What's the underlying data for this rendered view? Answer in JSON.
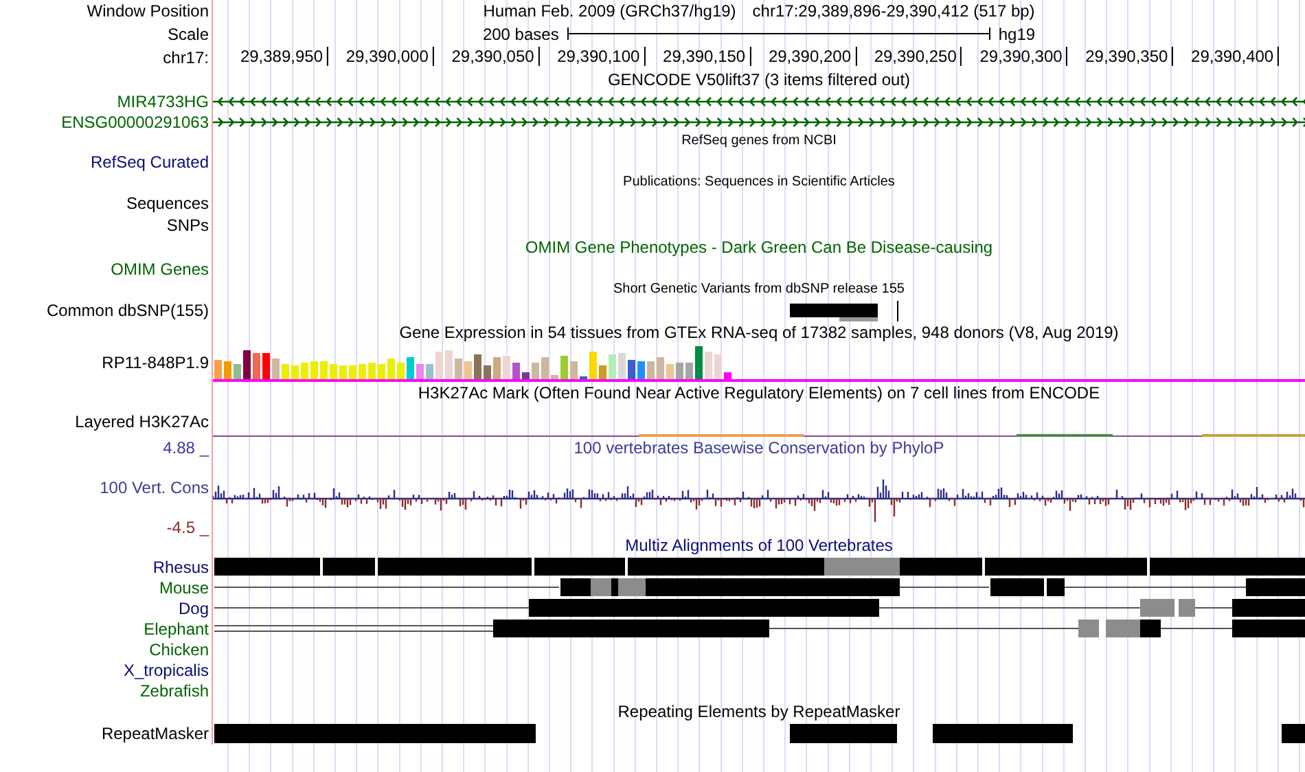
{
  "rows": [
    {
      "kind": "position",
      "label": "Window Position",
      "assembly": "Human Feb. 2009 (GRCh37/hg19)",
      "position": "chr17:29,389,896-29,390,412 (517 bp)"
    },
    {
      "kind": "scale",
      "label": "Scale",
      "bases": "200 bases",
      "db": "hg19"
    },
    {
      "kind": "ruler",
      "label": "chr17:",
      "ticks": [
        "29,389,950",
        "29,390,000",
        "29,390,050",
        "29,390,100",
        "29,390,150",
        "29,390,200",
        "29,390,250",
        "29,390,300",
        "29,390,350",
        "29,390,400"
      ]
    },
    {
      "kind": "title",
      "title": "GENCODE V50lift37 (3 items filtered out)",
      "color": "#000000"
    },
    {
      "kind": "gene",
      "label": "MIR4733HG",
      "color": "#006400",
      "reverse": true
    },
    {
      "kind": "gene",
      "label": "ENSG00000291063",
      "color": "#006400",
      "reverse": false
    },
    {
      "kind": "small_title",
      "title": "RefSeq genes from NCBI"
    },
    {
      "kind": "label",
      "label": "RefSeq Curated",
      "color": "#0c0c78"
    },
    {
      "kind": "small_title",
      "title": "Publications: Sequences in Scientific Articles"
    },
    {
      "kind": "label",
      "label": "Sequences",
      "color": "#000000"
    },
    {
      "kind": "label",
      "label": "SNPs",
      "color": "#000000"
    },
    {
      "kind": "title",
      "title": "OMIM Gene Phenotypes - Dark Green Can Be Disease-causing",
      "color": "#006400"
    },
    {
      "kind": "label",
      "label": "OMIM Genes",
      "color": "#006400"
    },
    {
      "kind": "small_title",
      "title": "Short Genetic Variants from dbSNP release 155"
    },
    {
      "kind": "snp",
      "label": "Common dbSNP(155)",
      "color": "#000000"
    },
    {
      "kind": "title",
      "title": "Gene Expression in 54 tissues from GTEx RNA-seq of 17382 samples, 948 donors (V8, Aug 2019)",
      "color": "#000000"
    },
    {
      "kind": "expression",
      "label": "RP11-848P1.9",
      "color": "#000000"
    },
    {
      "kind": "title",
      "title": "H3K27Ac Mark (Often Found Near Active Regulatory Elements) on 7 cell lines from ENCODE",
      "color": "#000000"
    },
    {
      "kind": "layered",
      "label": "Layered H3K27Ac",
      "color": "#000000"
    },
    {
      "kind": "phylop",
      "label": "100 Vert. Cons",
      "title": "100 vertebrates Basewise Conservation by PhyloP",
      "max": "4.88 _",
      "min": "-4.5 _",
      "color": "#3c3c96"
    },
    {
      "kind": "title",
      "title": "Multiz Alignments of 100 Vertebrates",
      "color": "#0c0c78"
    },
    {
      "kind": "species",
      "label": "Rhesus",
      "color": "#0c0c78"
    },
    {
      "kind": "species",
      "label": "Mouse",
      "color": "#006400"
    },
    {
      "kind": "species",
      "label": "Dog",
      "color": "#0c0c78"
    },
    {
      "kind": "species",
      "label": "Elephant",
      "color": "#006400"
    },
    {
      "kind": "species",
      "label": "Chicken",
      "color": "#006400"
    },
    {
      "kind": "species",
      "label": "X_tropicalis",
      "color": "#0c0c78"
    },
    {
      "kind": "species",
      "label": "Zebrafish",
      "color": "#006400"
    },
    {
      "kind": "title",
      "title": "Repeating Elements by RepeatMasker",
      "color": "#000000"
    },
    {
      "kind": "repeat",
      "label": "RepeatMasker",
      "color": "#000000"
    }
  ]
}
